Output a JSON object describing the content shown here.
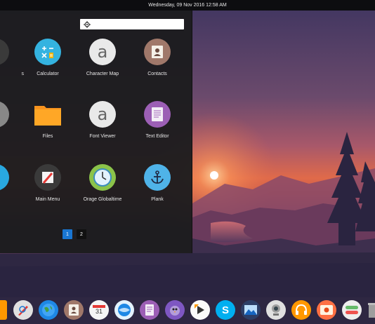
{
  "topbar": {
    "datetime": "Wednesday, 09 Nov 2016 12:58 AM"
  },
  "launcher": {
    "search": {
      "placeholder": "",
      "value": ""
    },
    "apps": [
      {
        "label": "s"
      },
      {
        "label": "Calculator"
      },
      {
        "label": "Character Map"
      },
      {
        "label": "Contacts"
      },
      {
        "label": ""
      },
      {
        "label": "Files"
      },
      {
        "label": "Font Viewer"
      },
      {
        "label": "Text Editor"
      },
      {
        "label": ""
      },
      {
        "label": "Main Menu"
      },
      {
        "label": "Orage Globaltime"
      },
      {
        "label": "Plank"
      }
    ],
    "pages": [
      "1",
      "2"
    ],
    "current_page": "1"
  },
  "dock": {
    "items": [
      "folder-icon",
      "drawing-icon",
      "globe-icon",
      "contacts-icon",
      "calendar-icon",
      "earth-icon",
      "document-icon",
      "pidgin-icon",
      "media-player-icon",
      "skype-icon",
      "image-viewer-icon",
      "webcam-icon",
      "headphones-icon",
      "photo-icon",
      "settings-icon",
      "trash-icon"
    ],
    "calendar_day": "31"
  },
  "colors": {
    "accent": "#1976d2",
    "panel": "#0d0d10",
    "launcher": "#1c1c1e"
  }
}
